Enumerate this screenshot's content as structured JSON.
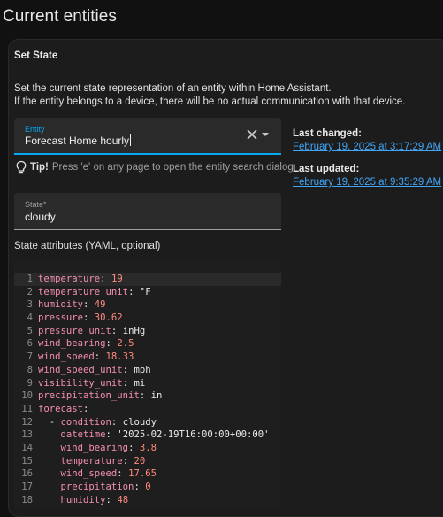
{
  "page": {
    "title": "Current entities"
  },
  "card": {
    "title": "Set State",
    "description_line1": "Set the current state representation of an entity within Home Assistant.",
    "description_line2": "If the entity belongs to a device, there will be no actual communication with that device."
  },
  "entity_field": {
    "label": "Entity",
    "value": "Forecast Home hourly"
  },
  "tip": {
    "bold": "Tip!",
    "text": "Press 'e' on any page to open the entity search dialog"
  },
  "state_field": {
    "label": "State*",
    "value": "cloudy"
  },
  "attributes": {
    "label": "State attributes (YAML, optional)",
    "lines": [
      {
        "n": "1",
        "indent": "",
        "dash": "",
        "key": "temperature",
        "val": "19",
        "vt": "n"
      },
      {
        "n": "2",
        "indent": "",
        "dash": "",
        "key": "temperature_unit",
        "val": "°F",
        "vt": "s"
      },
      {
        "n": "3",
        "indent": "",
        "dash": "",
        "key": "humidity",
        "val": "49",
        "vt": "n"
      },
      {
        "n": "4",
        "indent": "",
        "dash": "",
        "key": "pressure",
        "val": "30.62",
        "vt": "n"
      },
      {
        "n": "5",
        "indent": "",
        "dash": "",
        "key": "pressure_unit",
        "val": "inHg",
        "vt": "s"
      },
      {
        "n": "6",
        "indent": "",
        "dash": "",
        "key": "wind_bearing",
        "val": "2.5",
        "vt": "n"
      },
      {
        "n": "7",
        "indent": "",
        "dash": "",
        "key": "wind_speed",
        "val": "18.33",
        "vt": "n"
      },
      {
        "n": "8",
        "indent": "",
        "dash": "",
        "key": "wind_speed_unit",
        "val": "mph",
        "vt": "s"
      },
      {
        "n": "9",
        "indent": "",
        "dash": "",
        "key": "visibility_unit",
        "val": "mi",
        "vt": "s"
      },
      {
        "n": "10",
        "indent": "",
        "dash": "",
        "key": "precipitation_unit",
        "val": "in",
        "vt": "s"
      },
      {
        "n": "11",
        "indent": "",
        "dash": "",
        "key": "forecast",
        "val": "",
        "vt": "s"
      },
      {
        "n": "12",
        "indent": "  ",
        "dash": "- ",
        "key": "condition",
        "val": "cloudy",
        "vt": "s"
      },
      {
        "n": "13",
        "indent": "    ",
        "dash": "",
        "key": "datetime",
        "val": "'2025-02-19T16:00:00+00:00'",
        "vt": "s"
      },
      {
        "n": "14",
        "indent": "    ",
        "dash": "",
        "key": "wind_bearing",
        "val": "3.8",
        "vt": "n"
      },
      {
        "n": "15",
        "indent": "    ",
        "dash": "",
        "key": "temperature",
        "val": "20",
        "vt": "n"
      },
      {
        "n": "16",
        "indent": "    ",
        "dash": "",
        "key": "wind_speed",
        "val": "17.65",
        "vt": "n"
      },
      {
        "n": "17",
        "indent": "    ",
        "dash": "",
        "key": "precipitation",
        "val": "0",
        "vt": "n"
      },
      {
        "n": "18",
        "indent": "    ",
        "dash": "",
        "key": "humidity",
        "val": "48",
        "vt": "n"
      }
    ]
  },
  "last_changed": {
    "label": "Last changed:",
    "value": "February 19, 2025 at 3:17:29 AM"
  },
  "last_updated": {
    "label": "Last updated:",
    "value": "February 19, 2025 at 9:35:29 AM"
  },
  "colors": {
    "accent": "#03a9f4",
    "link": "#42a5f5",
    "key": "#f48fb1",
    "number": "#ff8a80"
  },
  "icons": {
    "clear": "close-icon",
    "dropdown": "menu-down-icon",
    "tip": "lightbulb-icon"
  }
}
